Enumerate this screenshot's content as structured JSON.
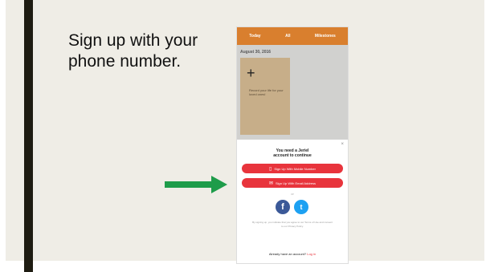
{
  "slide": {
    "heading_line1": "Sign up with your",
    "heading_line2": "phone number."
  },
  "colors": {
    "slide_bg": "#efede6",
    "left_bar": "#1e1c12",
    "arrow": "#1e9c4a",
    "app_header": "#d97f2e",
    "primary_button": "#e8343c",
    "facebook": "#3b5998",
    "twitter": "#1da1f2"
  },
  "phone": {
    "tabs": [
      "Today",
      "All",
      "Milestones"
    ],
    "date": "August 30, 2016",
    "card_text": "Record your life for your loved ones!",
    "modal": {
      "close": "×",
      "title_line1": "You need a Jeriel",
      "title_line2": "account to continue",
      "phone_button": "Sign Up With Mobile Number",
      "email_button": "Sign Up With Email Address",
      "or": "or",
      "terms": "By signing up, you indicate that you agree to our Terms of Use and consent to our Privacy Policy.",
      "already": "Already have an account?",
      "login": "Log in"
    },
    "icons": {
      "phone_button": "mobile-phone-icon",
      "email_button": "envelope-icon",
      "facebook": "facebook-icon",
      "twitter": "twitter-icon",
      "close": "close-icon"
    }
  }
}
